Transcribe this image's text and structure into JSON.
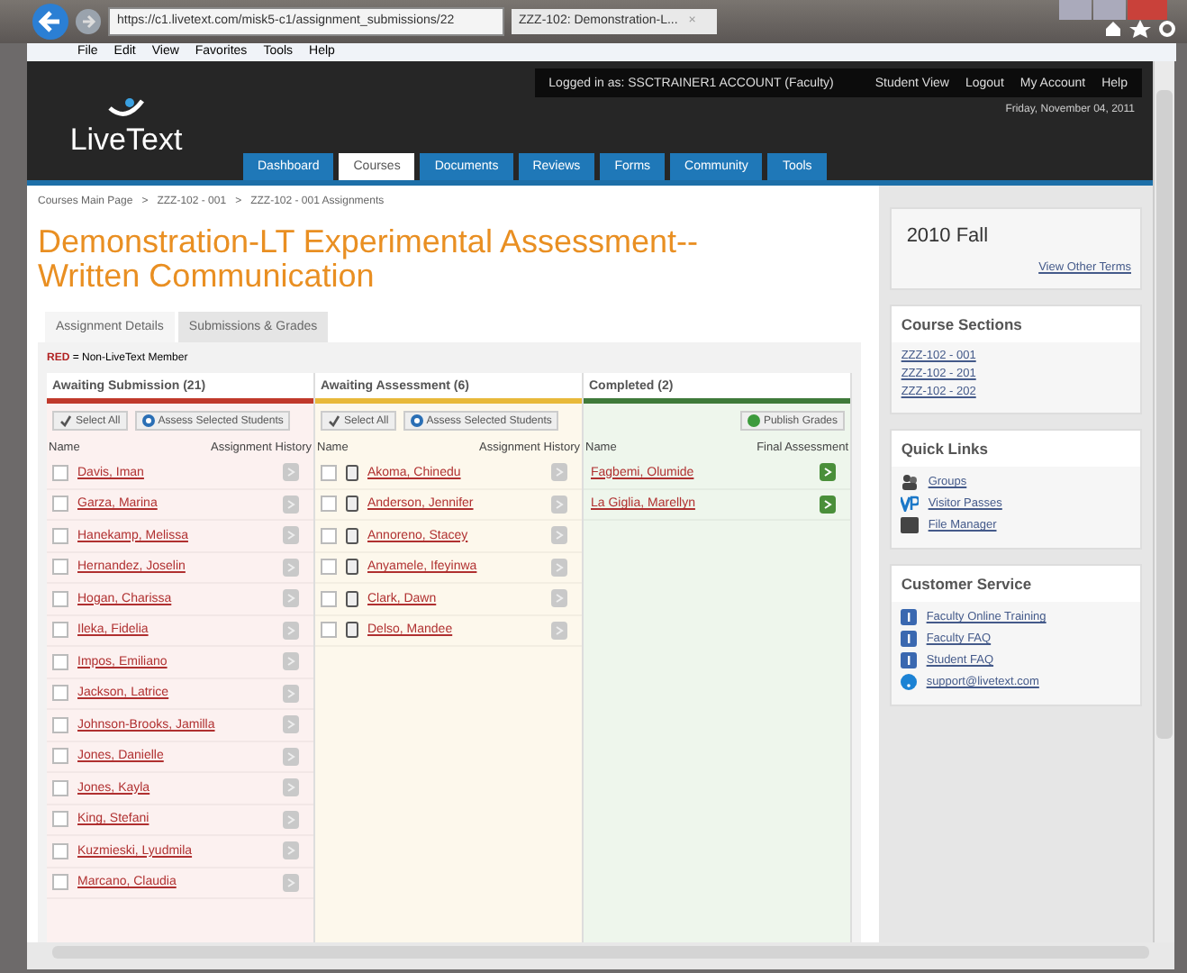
{
  "browser": {
    "url": "https://c1.livetext.com/misk5-c1/assignment_submissions/22",
    "tab_title": "ZZZ-102: Demonstration-L...",
    "tab_close": "×",
    "menu": [
      "File",
      "Edit",
      "View",
      "Favorites",
      "Tools",
      "Help"
    ]
  },
  "header": {
    "logo": "LiveText",
    "logged_in": "Logged in as:  SSCTRAINER1 ACCOUNT (Faculty)",
    "links": [
      "Student View",
      "Logout",
      "My Account",
      "Help"
    ],
    "date": "Friday, November 04, 2011",
    "nav": [
      {
        "label": "Dashboard",
        "selected": false
      },
      {
        "label": "Courses",
        "selected": true
      },
      {
        "label": "Documents",
        "selected": false
      },
      {
        "label": "Reviews",
        "selected": false
      },
      {
        "label": "Forms",
        "selected": false
      },
      {
        "label": "Community",
        "selected": false
      },
      {
        "label": "Tools",
        "selected": false
      }
    ]
  },
  "breadcrumb": [
    "Courses Main Page",
    "ZZZ-102 - 001",
    "ZZZ-102 - 001 Assignments"
  ],
  "breadcrumb_separator": ">",
  "title": "Demonstration-LT Experimental Assessment--Written Communication",
  "tabs": [
    {
      "label": "Assignment Details",
      "selected": false
    },
    {
      "label": "Submissions & Grades",
      "selected": true
    }
  ],
  "legend": {
    "key": "RED",
    "text": " = Non-LiveText Member"
  },
  "columns": [
    {
      "kind": "submission",
      "title": "Awaiting Submission (21)",
      "color": "#c0392b",
      "buttons": [
        {
          "kind": "select",
          "label": "Select All"
        },
        {
          "kind": "assess",
          "label": "Assess Selected Students"
        }
      ],
      "name_header": "Name",
      "action_header": "Assignment History",
      "rows": [
        {
          "name": "Davis, Iman",
          "checked": false
        },
        {
          "name": "Garza, Marina",
          "checked": false
        },
        {
          "name": "Hanekamp, Melissa",
          "checked": false
        },
        {
          "name": "Hernandez, Joselin",
          "checked": false
        },
        {
          "name": "Hogan, Charissa",
          "checked": false
        },
        {
          "name": "Ileka, Fidelia",
          "checked": false
        },
        {
          "name": "Impos, Emiliano",
          "checked": false
        },
        {
          "name": "Jackson, Latrice",
          "checked": false
        },
        {
          "name": "Johnson-Brooks, Jamilla",
          "checked": false
        },
        {
          "name": "Jones, Danielle",
          "checked": false
        },
        {
          "name": "Jones, Kayla",
          "checked": false
        },
        {
          "name": "King, Stefani",
          "checked": false
        },
        {
          "name": "Kuzmieski, Lyudmila",
          "checked": false
        },
        {
          "name": "Marcano, Claudia",
          "checked": false
        }
      ]
    },
    {
      "kind": "assessment",
      "title": "Awaiting Assessment (6)",
      "color": "#e8b93a",
      "buttons": [
        {
          "kind": "select",
          "label": "Select All"
        },
        {
          "kind": "assess",
          "label": "Assess Selected Students"
        }
      ],
      "name_header": "Name",
      "action_header": "Assignment History",
      "rows": [
        {
          "name": "Akoma, Chinedu",
          "checked": false
        },
        {
          "name": "Anderson, Jennifer",
          "checked": false
        },
        {
          "name": "Annoreno, Stacey",
          "checked": false
        },
        {
          "name": "Anyamele, Ifeyinwa",
          "checked": false
        },
        {
          "name": "Clark, Dawn",
          "checked": false
        },
        {
          "name": "Delso, Mandee",
          "checked": false
        }
      ]
    },
    {
      "kind": "completed",
      "title": "Completed (2)",
      "color": "#3f7a3a",
      "buttons": [
        {
          "kind": "publish",
          "label": "Publish Grades"
        }
      ],
      "name_header": "Name",
      "action_header": "Final Assessment",
      "rows": [
        {
          "name": "Fagbemi, Olumide"
        },
        {
          "name": "La Giglia, Marellyn"
        }
      ]
    }
  ],
  "sidebar": [
    {
      "kind": "term",
      "title": "2010 Fall",
      "link": "View Other Terms"
    },
    {
      "kind": "links",
      "title": "Course Sections",
      "items": [
        {
          "kind": "plain",
          "label": "ZZZ-102 - 001"
        },
        {
          "kind": "plain",
          "label": "ZZZ-102 - 201"
        },
        {
          "kind": "plain",
          "label": "ZZZ-102 - 202"
        }
      ]
    },
    {
      "kind": "links",
      "title": "Quick Links",
      "items": [
        {
          "kind": "groups",
          "label": "Groups"
        },
        {
          "kind": "passes",
          "label": "Visitor Passes"
        },
        {
          "kind": "files",
          "label": "File Manager"
        }
      ]
    },
    {
      "kind": "links",
      "title": "Customer Service",
      "items": [
        {
          "kind": "info",
          "label": "Faculty Online Training"
        },
        {
          "kind": "info",
          "label": "Faculty FAQ"
        },
        {
          "kind": "info",
          "label": "Student FAQ"
        },
        {
          "kind": "help",
          "label": "support@livetext.com"
        }
      ]
    }
  ]
}
